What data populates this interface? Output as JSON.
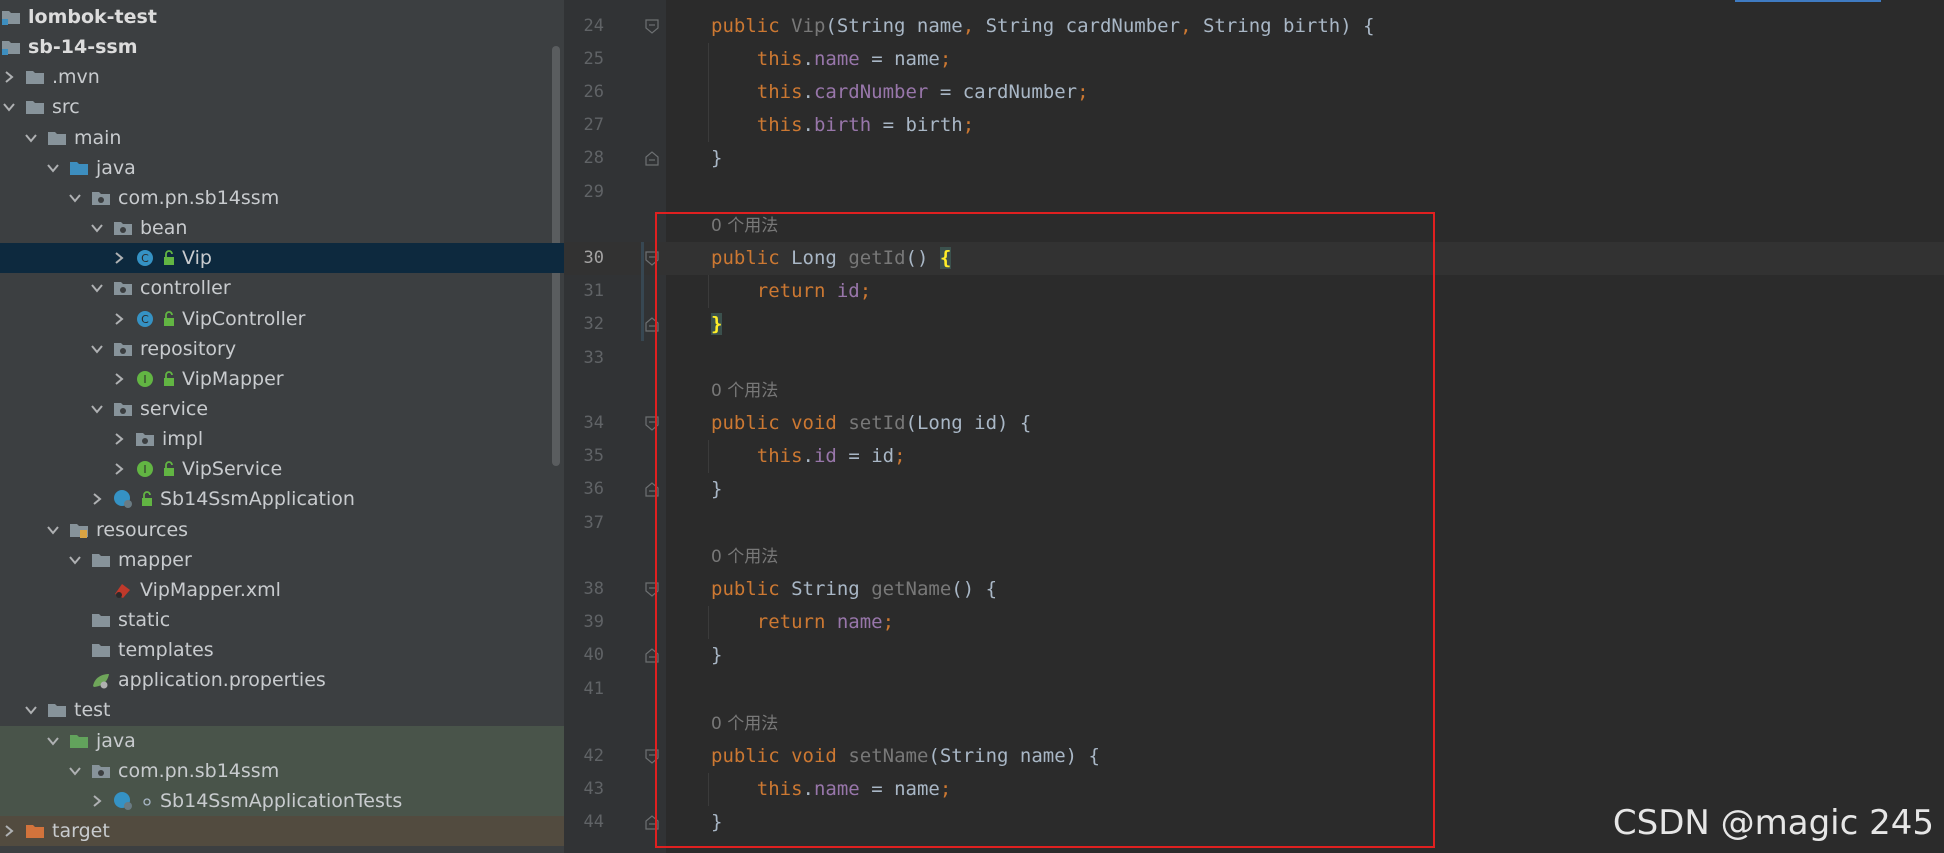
{
  "project_tree": {
    "rows": [
      {
        "label": "lombok-test",
        "bold": true
      },
      {
        "label": "sb-14-ssm",
        "bold": true
      },
      {
        "label": ".mvn"
      },
      {
        "label": "src"
      },
      {
        "label": "main"
      },
      {
        "label": "java"
      },
      {
        "label": "com.pn.sb14ssm"
      },
      {
        "label": "bean"
      },
      {
        "label": "Vip",
        "selected": true
      },
      {
        "label": "controller"
      },
      {
        "label": "VipController"
      },
      {
        "label": "repository"
      },
      {
        "label": "VipMapper"
      },
      {
        "label": "service"
      },
      {
        "label": "impl"
      },
      {
        "label": "VipService"
      },
      {
        "label": "Sb14SsmApplication"
      },
      {
        "label": "resources"
      },
      {
        "label": "mapper"
      },
      {
        "label": "VipMapper.xml"
      },
      {
        "label": "static"
      },
      {
        "label": "templates"
      },
      {
        "label": "application.properties"
      },
      {
        "label": "test"
      },
      {
        "label": "java"
      },
      {
        "label": "com.pn.sb14ssm"
      },
      {
        "label": "Sb14SsmApplicationTests"
      },
      {
        "label": "target"
      }
    ]
  },
  "editor": {
    "current_line": "30",
    "usage_hint": "0 个用法",
    "lines": [
      {
        "num": "24"
      },
      {
        "num": "25"
      },
      {
        "num": "26"
      },
      {
        "num": "27"
      },
      {
        "num": "28"
      },
      {
        "num": "29"
      },
      {
        "num": "30"
      },
      {
        "num": "31"
      },
      {
        "num": "32"
      },
      {
        "num": "33"
      },
      {
        "num": "34"
      },
      {
        "num": "35"
      },
      {
        "num": "36"
      },
      {
        "num": "37"
      },
      {
        "num": "38"
      },
      {
        "num": "39"
      },
      {
        "num": "40"
      },
      {
        "num": "41"
      },
      {
        "num": "42"
      },
      {
        "num": "43"
      },
      {
        "num": "44"
      }
    ],
    "tokens": {
      "public": "public",
      "void": "void",
      "this": "this",
      "return": "return",
      "string": "String",
      "long": "Long",
      "vip_ctor": "Vip",
      "get_id": "getId",
      "set_id": "setId",
      "get_name": "getName",
      "set_name": "setName",
      "name": "name",
      "card_number": "cardNumber",
      "birth": "birth",
      "id": "id",
      "ctor_params_1": "(String name",
      "ctor_params_2": " String cardNumber",
      "ctor_params_3": " String birth) {",
      "comma": ",",
      "assign_name": " = name",
      "assign_card": " = cardNumber",
      "assign_birth": " = birth",
      "assign_id": " = id",
      "semi": ";",
      "close_brace": "}",
      "open_brace": "{",
      "empty_parens_space": "() ",
      "empty_parens_brace": "() {",
      "long_id_param": "(Long id) {",
      "string_name_param": "(String name) {"
    }
  },
  "watermark": "CSDN @magic 245",
  "colors": {
    "keyword": "#cc7832",
    "field": "#9876aa",
    "text": "#a9b7c6",
    "highlight_box": "#e02020"
  }
}
